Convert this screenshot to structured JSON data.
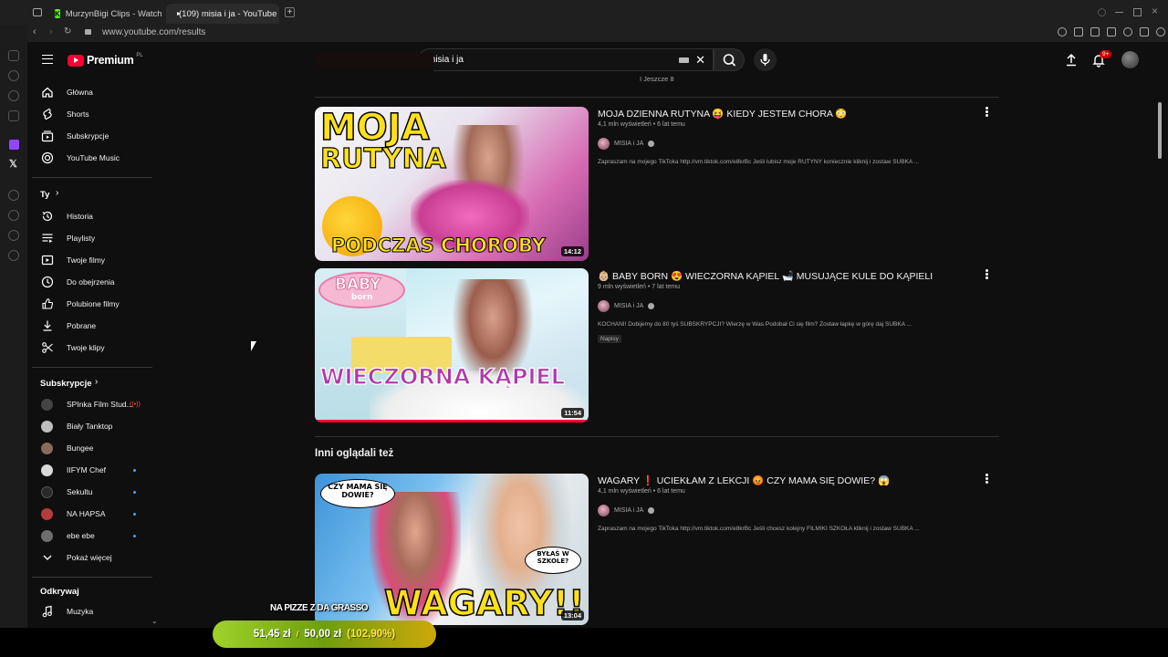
{
  "browser": {
    "tabs": [
      {
        "label": "MurzynBigi Clips - Watch"
      },
      {
        "label": "(109) misia i ja - YouTube"
      }
    ],
    "url": "www.youtube.com/results"
  },
  "header": {
    "logo_word": "Premium",
    "logo_country": "PL",
    "search_value": "misia i ja",
    "notification_badge": "9+"
  },
  "sidebar": {
    "main_items": [
      {
        "label": "Główna",
        "icon": "home-icon"
      },
      {
        "label": "Shorts",
        "icon": "shorts-icon"
      },
      {
        "label": "Subskrypcje",
        "icon": "subscriptions-icon"
      },
      {
        "label": "YouTube Music",
        "icon": "music-icon"
      }
    ],
    "you_section": "Ty",
    "you_items": [
      {
        "label": "Historia",
        "icon": "history-icon"
      },
      {
        "label": "Playlisty",
        "icon": "playlist-icon"
      },
      {
        "label": "Twoje filmy",
        "icon": "your-videos-icon"
      },
      {
        "label": "Do obejrzenia",
        "icon": "watch-later-icon"
      },
      {
        "label": "Polubione filmy",
        "icon": "like-icon"
      },
      {
        "label": "Pobrane",
        "icon": "download-icon"
      },
      {
        "label": "Twoje klipy",
        "icon": "scissors-icon"
      }
    ],
    "subs_section": "Subskrypcje",
    "subs_items": [
      {
        "label": "SPInka Film Stud...",
        "color": "#444444",
        "indicator": "live"
      },
      {
        "label": "Biały Tanktop",
        "color": "#bfbfbf",
        "indicator": ""
      },
      {
        "label": "Bungee",
        "color": "#8a6a5a",
        "indicator": ""
      },
      {
        "label": "IIFYM Chef",
        "color": "#d9d9d9",
        "indicator": "dot"
      },
      {
        "label": "Sekultu",
        "color": "#2a2a2a",
        "indicator": "dot"
      },
      {
        "label": "NA HAPSA",
        "color": "#b83a3a",
        "indicator": "dot"
      },
      {
        "label": "ebe ebe",
        "color": "#6e6e6e",
        "indicator": "dot"
      }
    ],
    "show_more": "Pokaż więcej",
    "explore_section": "Odkrywaj",
    "explore_items": [
      {
        "label": "Muzyka",
        "icon": "music-note-icon"
      }
    ]
  },
  "results": {
    "more_text": "I Jeszcze 8",
    "shelf_title": "Inni oglądali też",
    "videos": [
      {
        "title": "MOJA DZIENNA RUTYNA 😝 KIEDY JESTEM CHORA 😳",
        "meta": "4,1 mln wyświetleń • 6 lat temu",
        "channel": "MISIA i JA",
        "description": "Zapraszam na mojego TikToka http://vm.tiktok.com/e8krBc Jeśli lubisz moje RUTYNY koniecznie kliknij i zostaw SUBKA ...",
        "duration": "14:12",
        "tag": "",
        "art_lines": [
          "MOJA",
          "RUTYNA",
          "PODCZAS CHOROBY"
        ]
      },
      {
        "title": "👶🏼 BABY BORN 😍 WIECZORNA KĄPIEL 🛁 MUSUJĄCE KULE DO KĄPIELI",
        "meta": "9 mln wyświetleń • 7 lat temu",
        "channel": "MISIA i JA",
        "description": "KOCHANI! Dobijemy do 80 tyś SUBSKRYPCJI? Wierzę w Was Podobał Ci się film? Zostaw łapkę w górę daj SUBKA ...",
        "duration": "11:54",
        "tag": "Napisy",
        "art_lines": [
          "BABY",
          "born",
          "WIECZORNA KĄPIEL"
        ]
      },
      {
        "title": "WAGARY ❗ UCIEKŁAM Z LEKCJI 😡 CZY MAMA SIĘ DOWIE? 😱",
        "meta": "4,1 mln wyświetleń • 6 lat temu",
        "channel": "MISIA i JA",
        "description": "Zapraszam na mojego TikToka http://vm.tiktok.com/e8krBc Jeśli chcesz kolejny FILMIKI SZKOŁA kliknij i zostaw SUBKA ...",
        "duration": "13:04",
        "tag": "",
        "art_lines": [
          "CZY MAMA SIĘ DOWIE?",
          "BYŁAŚ W SZKOLE?",
          "WAGARY!!!"
        ]
      }
    ]
  },
  "overlay": {
    "title": "NA PIZZE Z DA GRASSO",
    "current": "51,45 zł",
    "separator": "/",
    "goal": "50,00 zł",
    "percent": "(102,90%)"
  }
}
